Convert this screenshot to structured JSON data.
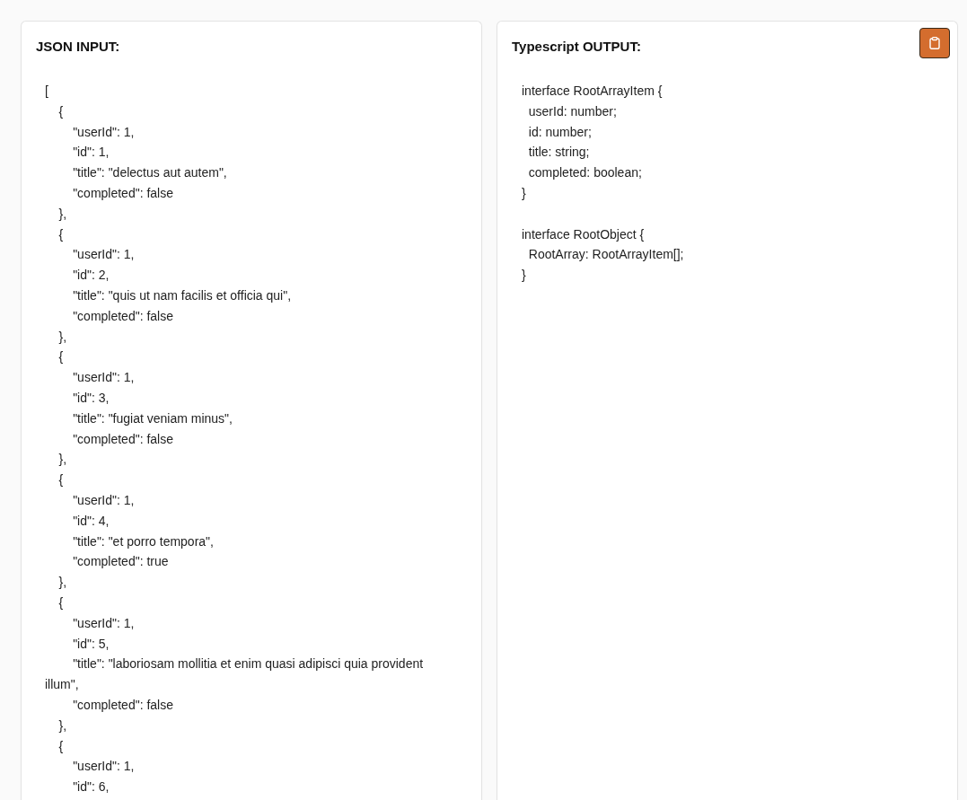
{
  "input_panel": {
    "title": "JSON INPUT:",
    "lines": [
      "[",
      "    {",
      "        \"userId\": 1,",
      "        \"id\": 1,",
      "        \"title\": \"delectus aut autem\",",
      "        \"completed\": false",
      "    },",
      "    {",
      "        \"userId\": 1,",
      "        \"id\": 2,",
      "        \"title\": \"quis ut nam facilis et officia qui\",",
      "        \"completed\": false",
      "    },",
      "    {",
      "        \"userId\": 1,",
      "        \"id\": 3,",
      "        \"title\": \"fugiat veniam minus\",",
      "        \"completed\": false",
      "    },",
      "    {",
      "        \"userId\": 1,",
      "        \"id\": 4,",
      "        \"title\": \"et porro tempora\",",
      "        \"completed\": true",
      "    },",
      "    {",
      "        \"userId\": 1,",
      "        \"id\": 5,",
      "        \"title\": \"laboriosam mollitia et enim quasi adipisci quia provident illum\",",
      "        \"completed\": false",
      "    },",
      "    {",
      "        \"userId\": 1,",
      "        \"id\": 6,"
    ]
  },
  "output_panel": {
    "title": "Typescript OUTPUT:",
    "copy_button": {
      "kind": "icon"
    },
    "blocks": [
      [
        "interface RootArrayItem {",
        "  userId: number;",
        "  id: number;",
        "  title: string;",
        "  completed: boolean;",
        "}"
      ],
      [
        "interface RootObject {",
        "  RootArray: RootArrayItem[];",
        "}"
      ]
    ]
  }
}
